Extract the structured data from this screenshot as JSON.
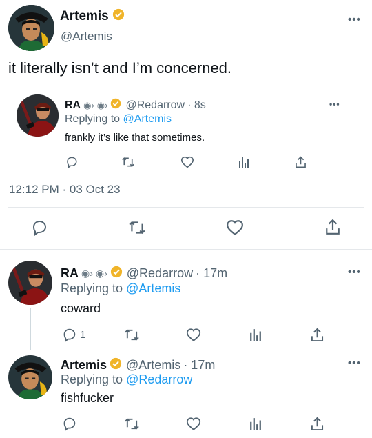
{
  "main_tweet": {
    "display_name": "Artemis",
    "handle": "@Artemis",
    "text": "it literally isn’t and I’m concerned.",
    "timestamp": "12:12 PM · 03 Oct 23"
  },
  "quoted_reply": {
    "display_name": "RA",
    "handle": "@Redarrow",
    "time": "· 8s",
    "replying_prefix": "Replying to",
    "replying_to": "@Artemis",
    "text": "frankly it’s like that sometimes."
  },
  "reply_1": {
    "display_name": "RA",
    "handle": "@Redarrow",
    "time": "· 17m",
    "replying_prefix": "Replying to",
    "replying_to": "@Artemis",
    "text": "coward",
    "reply_count": "1"
  },
  "reply_2": {
    "display_name": "Artemis",
    "handle": "@Artemis",
    "time": "· 17m",
    "replying_prefix": "Replying to",
    "replying_to": "@Redarrow",
    "text": "fishfucker"
  },
  "more_label": "•••",
  "colors": {
    "accent": "#1d9bf0",
    "verified": "#f0b429",
    "muted": "#536471",
    "divider": "#e5e8eb"
  },
  "icons": [
    "reply-icon",
    "retweet-icon",
    "like-icon",
    "views-icon",
    "share-icon",
    "verified-badge-icon",
    "speaking-head-icon"
  ]
}
